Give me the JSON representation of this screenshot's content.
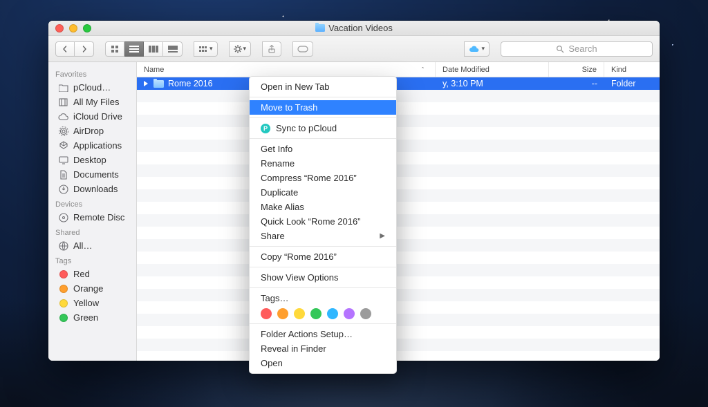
{
  "window": {
    "title": "Vacation Videos"
  },
  "toolbar": {
    "search_placeholder": "Search",
    "cloud_label": "cloud"
  },
  "sidebar": {
    "sections": [
      {
        "header": "Favorites",
        "items": [
          {
            "label": "pCloud…",
            "icon": "folder"
          },
          {
            "label": "All My Files",
            "icon": "allfiles"
          },
          {
            "label": "iCloud Drive",
            "icon": "icloud"
          },
          {
            "label": "AirDrop",
            "icon": "airdrop"
          },
          {
            "label": "Applications",
            "icon": "apps"
          },
          {
            "label": "Desktop",
            "icon": "desktop"
          },
          {
            "label": "Documents",
            "icon": "documents"
          },
          {
            "label": "Downloads",
            "icon": "downloads"
          }
        ]
      },
      {
        "header": "Devices",
        "items": [
          {
            "label": "Remote Disc",
            "icon": "remotedisc"
          }
        ]
      },
      {
        "header": "Shared",
        "items": [
          {
            "label": "All…",
            "icon": "network"
          }
        ]
      },
      {
        "header": "Tags",
        "items": [
          {
            "label": "Red",
            "icon": "tag",
            "color": "#ff5b5b"
          },
          {
            "label": "Orange",
            "icon": "tag",
            "color": "#ff9f2e"
          },
          {
            "label": "Yellow",
            "icon": "tag",
            "color": "#ffd93b"
          },
          {
            "label": "Green",
            "icon": "tag",
            "color": "#34c759"
          }
        ]
      }
    ]
  },
  "columns": {
    "name": "Name",
    "date": "Date Modified",
    "size": "Size",
    "kind": "Kind"
  },
  "rows": [
    {
      "name": "Rome 2016",
      "date_visible": "y, 3:10 PM",
      "size": "--",
      "kind": "Folder",
      "selected": true
    }
  ],
  "context_menu": {
    "items": [
      {
        "label": "Open in New Tab"
      }
    ],
    "highlighted": "Move to Trash",
    "sync": "Sync to pCloud",
    "group2": [
      "Get Info",
      "Rename",
      "Compress “Rome 2016”",
      "Duplicate",
      "Make Alias",
      "Quick Look “Rome 2016”"
    ],
    "share": "Share",
    "copy": "Copy “Rome 2016”",
    "view_options": "Show View Options",
    "tags_label": "Tags…",
    "tag_colors": [
      "#ff5b5b",
      "#ff9f2e",
      "#ffd93b",
      "#34c759",
      "#30b7ff",
      "#b574ff",
      "#9b9b9b"
    ],
    "group3": [
      "Folder Actions Setup…",
      "Reveal in Finder",
      "Open"
    ]
  },
  "blank_row_count": 22
}
